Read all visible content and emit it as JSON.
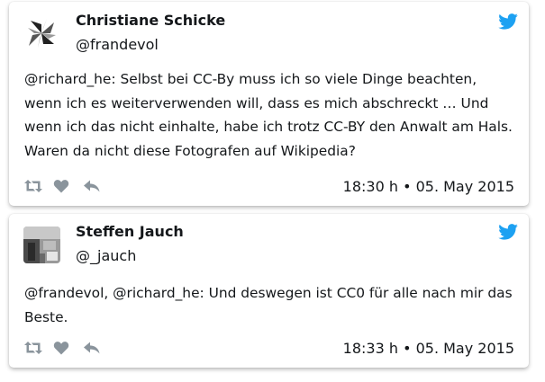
{
  "tweets": [
    {
      "author_name": "Christiane Schicke",
      "handle": "@frandevol",
      "text": "@richard_he: Selbst bei CC-By muss ich so viele Dinge beachten, wenn ich es weiterverwenden will, dass es mich abschreckt … Und wenn ich das nicht einhalte, habe ich trotz CC-BY den Anwalt am Hals. Waren da nicht diese Fotografen auf Wikipedia?",
      "timestamp": "18:30 h • 05. May 2015"
    },
    {
      "author_name": "Steffen Jauch",
      "handle": "@_jauch",
      "text": "@frandevol, @richard_he: Und deswegen ist CC0 für alle nach mir das Beste.",
      "timestamp": "18:33 h • 05. May 2015"
    }
  ],
  "icons": {
    "brand": "twitter-bird-icon",
    "actions": [
      "retweet-icon",
      "like-heart-icon",
      "reply-icon"
    ]
  },
  "colors": {
    "twitter_blue": "#1da1f2",
    "action_gray": "#8a949c",
    "text": "#14171a"
  }
}
